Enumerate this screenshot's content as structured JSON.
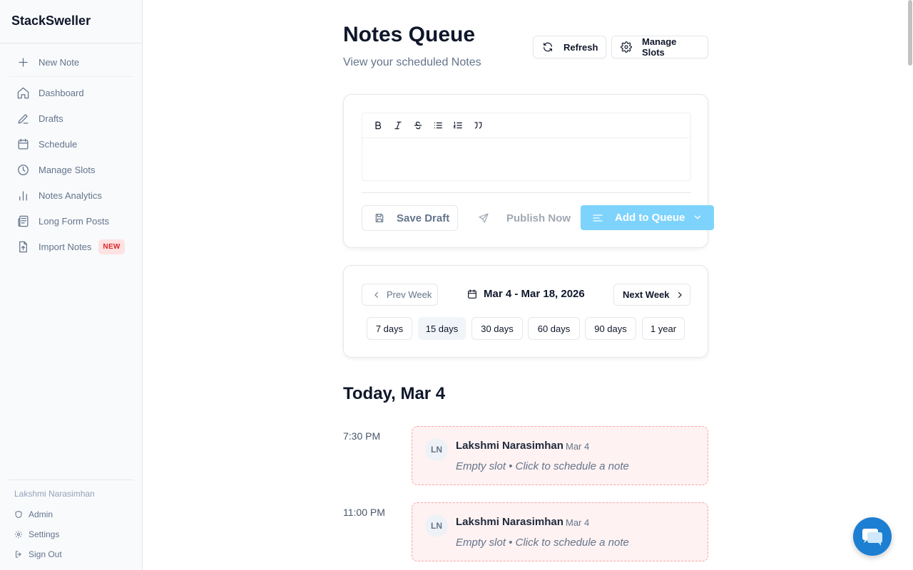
{
  "app": {
    "name": "StackSweller"
  },
  "sidebar": {
    "items": [
      {
        "label": "New Note",
        "icon": "plus-icon"
      },
      {
        "label": "Dashboard",
        "icon": "home-icon"
      },
      {
        "label": "Drafts",
        "icon": "pencil-icon"
      },
      {
        "label": "Schedule",
        "icon": "calendar-icon"
      },
      {
        "label": "Manage Slots",
        "icon": "clock-icon"
      },
      {
        "label": "Notes Analytics",
        "icon": "bar-chart-icon"
      },
      {
        "label": "Long Form Posts",
        "icon": "newspaper-icon"
      },
      {
        "label": "Import Notes",
        "icon": "file-upload-icon",
        "badge": "NEW"
      }
    ],
    "footer": {
      "user": "Lakshmi Narasimhan",
      "items": [
        {
          "label": "Admin",
          "icon": "shield-icon"
        },
        {
          "label": "Settings",
          "icon": "gear-icon"
        },
        {
          "label": "Sign Out",
          "icon": "sign-out-icon"
        }
      ]
    }
  },
  "header": {
    "title": "Notes Queue",
    "subtitle": "View your scheduled Notes",
    "refresh_label": "Refresh",
    "manage_slots_label": "Manage Slots"
  },
  "editor": {
    "toolbar": [
      "bold-icon",
      "italic-icon",
      "strikethrough-icon",
      "bullet-list-icon",
      "numbered-list-icon",
      "quote-icon"
    ],
    "content": "",
    "save_draft_label": "Save Draft",
    "publish_now_label": "Publish Now",
    "add_to_queue_label": "Add to Queue"
  },
  "range": {
    "prev_label": "Prev Week",
    "label": "Mar 4 - Mar 18, 2026",
    "next_label": "Next Week",
    "presets": [
      "7 days",
      "15 days",
      "30 days",
      "60 days",
      "90 days",
      "1 year"
    ],
    "active_preset": "15 days"
  },
  "schedule": {
    "day_title": "Today, Mar 4",
    "slots": [
      {
        "time": "7:30 PM",
        "initials": "LN",
        "name": "Lakshmi Narasimhan",
        "date": "Mar 4",
        "status": "Empty slot • Click to schedule a note"
      },
      {
        "time": "11:00 PM",
        "initials": "LN",
        "name": "Lakshmi Narasimhan",
        "date": "Mar 4",
        "status": "Empty slot • Click to schedule a note"
      }
    ]
  },
  "colors": {
    "accent": "#7dd3fc",
    "empty_slot_bg": "#fef2f2",
    "empty_slot_border": "#fca5a5",
    "new_badge": "#dc2626",
    "chat": "#1d7fd1"
  }
}
